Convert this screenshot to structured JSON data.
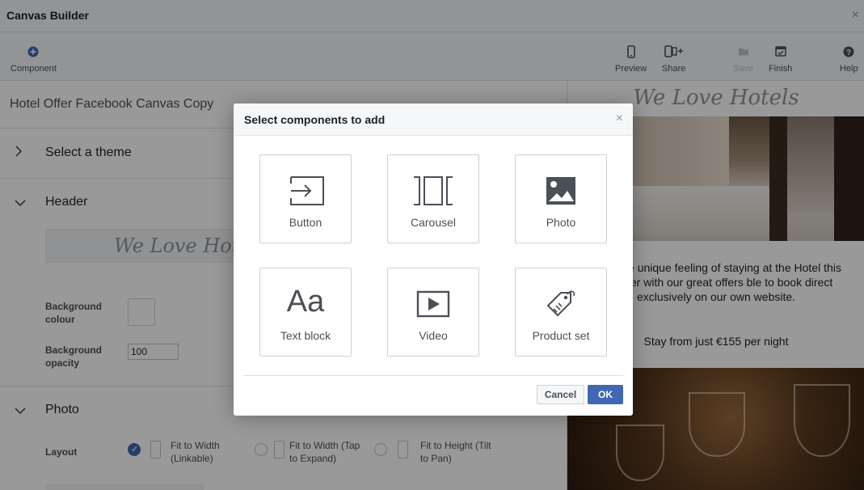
{
  "window": {
    "title": "Canvas Builder",
    "close_glyph": "×"
  },
  "toolbar": {
    "component": {
      "label": "Component",
      "icon": "plus-circle-icon"
    },
    "preview": {
      "label": "Preview",
      "icon": "phone-icon"
    },
    "share": {
      "label": "Share",
      "icon": "share-device-icon"
    },
    "save": {
      "label": "Save",
      "icon": "folder-icon",
      "disabled": true
    },
    "finish": {
      "label": "Finish",
      "icon": "finish-icon"
    },
    "help": {
      "label": "Help",
      "icon": "help-icon"
    }
  },
  "editor": {
    "doc_title": "Hotel Offer Facebook Canvas Copy",
    "theme_section": "Select a theme",
    "header_section": "Header",
    "header_preview_text": "We Love Hotels",
    "bg_colour_label": "Background colour",
    "bg_opacity_label": "Background opacity",
    "bg_opacity_value": "100",
    "photo_section": "Photo",
    "layout_label": "Layout",
    "layout_options": [
      {
        "label": "Fit to Width (Linkable)",
        "selected": true
      },
      {
        "label": "Fit to Width (Tap to Expand)",
        "selected": false
      },
      {
        "label": "Fit to Height (Tilt to Pan)",
        "selected": false
      }
    ]
  },
  "preview_panel": {
    "brand": "We Love Hotels",
    "offer_text": "ence the unique feeling of staying at the Hotel this summer with our great offers ble to book direct exclusively on our own website.",
    "price_text": "Stay from just €155 per night"
  },
  "modal": {
    "title": "Select components to add",
    "close_glyph": "×",
    "components": [
      {
        "label": "Button",
        "icon": "button-arrow-icon"
      },
      {
        "label": "Carousel",
        "icon": "carousel-icon"
      },
      {
        "label": "Photo",
        "icon": "photo-icon"
      },
      {
        "label": "Text block",
        "icon": "text-block-icon",
        "glyph": "Aa"
      },
      {
        "label": "Video",
        "icon": "video-icon"
      },
      {
        "label": "Product set",
        "icon": "tag-icon"
      }
    ],
    "cancel_label": "Cancel",
    "ok_label": "OK"
  },
  "colors": {
    "accent": "#4267b2",
    "overlay": "rgba(0,0,0,0.4)",
    "border": "#ccd0d5"
  }
}
